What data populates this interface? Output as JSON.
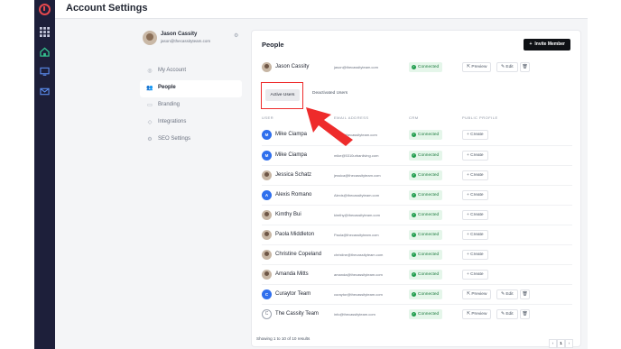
{
  "page": {
    "title": "Account Settings"
  },
  "colors": {
    "rail": "#1d1f3a",
    "accent_red": "#ee2b2b",
    "connected_green": "#1f9d4c",
    "avatar_blue": "#2f6fed"
  },
  "rail": {
    "icons": [
      "logo-icon",
      "grid-icon",
      "home-icon",
      "monitor-icon",
      "mail-icon"
    ]
  },
  "profile": {
    "name": "Jason Cassity",
    "email": "jason@thecassityteam.com"
  },
  "nav": [
    {
      "label": "My Account",
      "icon": "user-icon"
    },
    {
      "label": "People",
      "icon": "people-icon",
      "active": true
    },
    {
      "label": "Branding",
      "icon": "branding-icon"
    },
    {
      "label": "Integrations",
      "icon": "integrations-icon"
    },
    {
      "label": "SEO Settings",
      "icon": "seo-icon"
    }
  ],
  "panel": {
    "title": "People",
    "invite_label": "Invite Member",
    "owner": {
      "name": "Jason Cassity",
      "email": "jason@thecassityteam.com",
      "crm": "Connected",
      "preview": "Preview",
      "edit": "Edit"
    },
    "tabs": {
      "active": "Active Users",
      "inactive": "Deactivated Users"
    },
    "columns": {
      "user": "USER",
      "email": "EMAIL ADDRESS",
      "crm": "CRM",
      "profile": "PUBLIC PROFILE"
    },
    "rows": [
      {
        "name": "Mike Ciampa",
        "email": "mike@thecassityteam.com",
        "crm": "Connected",
        "avatar": "M",
        "avatar_type": "initial",
        "action": "create"
      },
      {
        "name": "Mike Ciampa",
        "email": "mike@5310urbanliving.com",
        "crm": "Connected",
        "avatar": "M",
        "avatar_type": "initial",
        "action": "create"
      },
      {
        "name": "Jessica Schatz",
        "email": "jessica@thecassityteam.com",
        "crm": "Connected",
        "avatar": "",
        "avatar_type": "photo",
        "action": "create"
      },
      {
        "name": "Alexis Romano",
        "email": "Alexis@thecassityteam.com",
        "crm": "Connected",
        "avatar": "A",
        "avatar_type": "initial",
        "action": "create"
      },
      {
        "name": "Kimthy Bui",
        "email": "kimthy@thecassityteam.com",
        "crm": "Connected",
        "avatar": "",
        "avatar_type": "photo",
        "action": "create"
      },
      {
        "name": "Paola Middleton",
        "email": "Paola@thecassityteam.com",
        "crm": "Connected",
        "avatar": "",
        "avatar_type": "photo",
        "action": "create"
      },
      {
        "name": "Christine Copeland",
        "email": "christine@thecassityteam.com",
        "crm": "Connected",
        "avatar": "",
        "avatar_type": "photo",
        "action": "create"
      },
      {
        "name": "Amanda Mitts",
        "email": "amanda@thecassityteam.com",
        "crm": "Connected",
        "avatar": "",
        "avatar_type": "photo",
        "action": "create"
      },
      {
        "name": "Curaytor Team",
        "email": "curaytor@thecassityteam.com",
        "crm": "Connected",
        "avatar": "C",
        "avatar_type": "initial",
        "action": "manage"
      },
      {
        "name": "The Cassity Team",
        "email": "info@thecassityteam.com",
        "crm": "Connected",
        "avatar": "C",
        "avatar_type": "logo",
        "action": "manage"
      }
    ],
    "labels": {
      "create": "Create",
      "preview": "Preview",
      "edit": "Edit"
    },
    "footer": "Showing 1 to 10 of 10 results",
    "pagination": {
      "current": "1",
      "prev": "‹",
      "next": "›"
    }
  }
}
